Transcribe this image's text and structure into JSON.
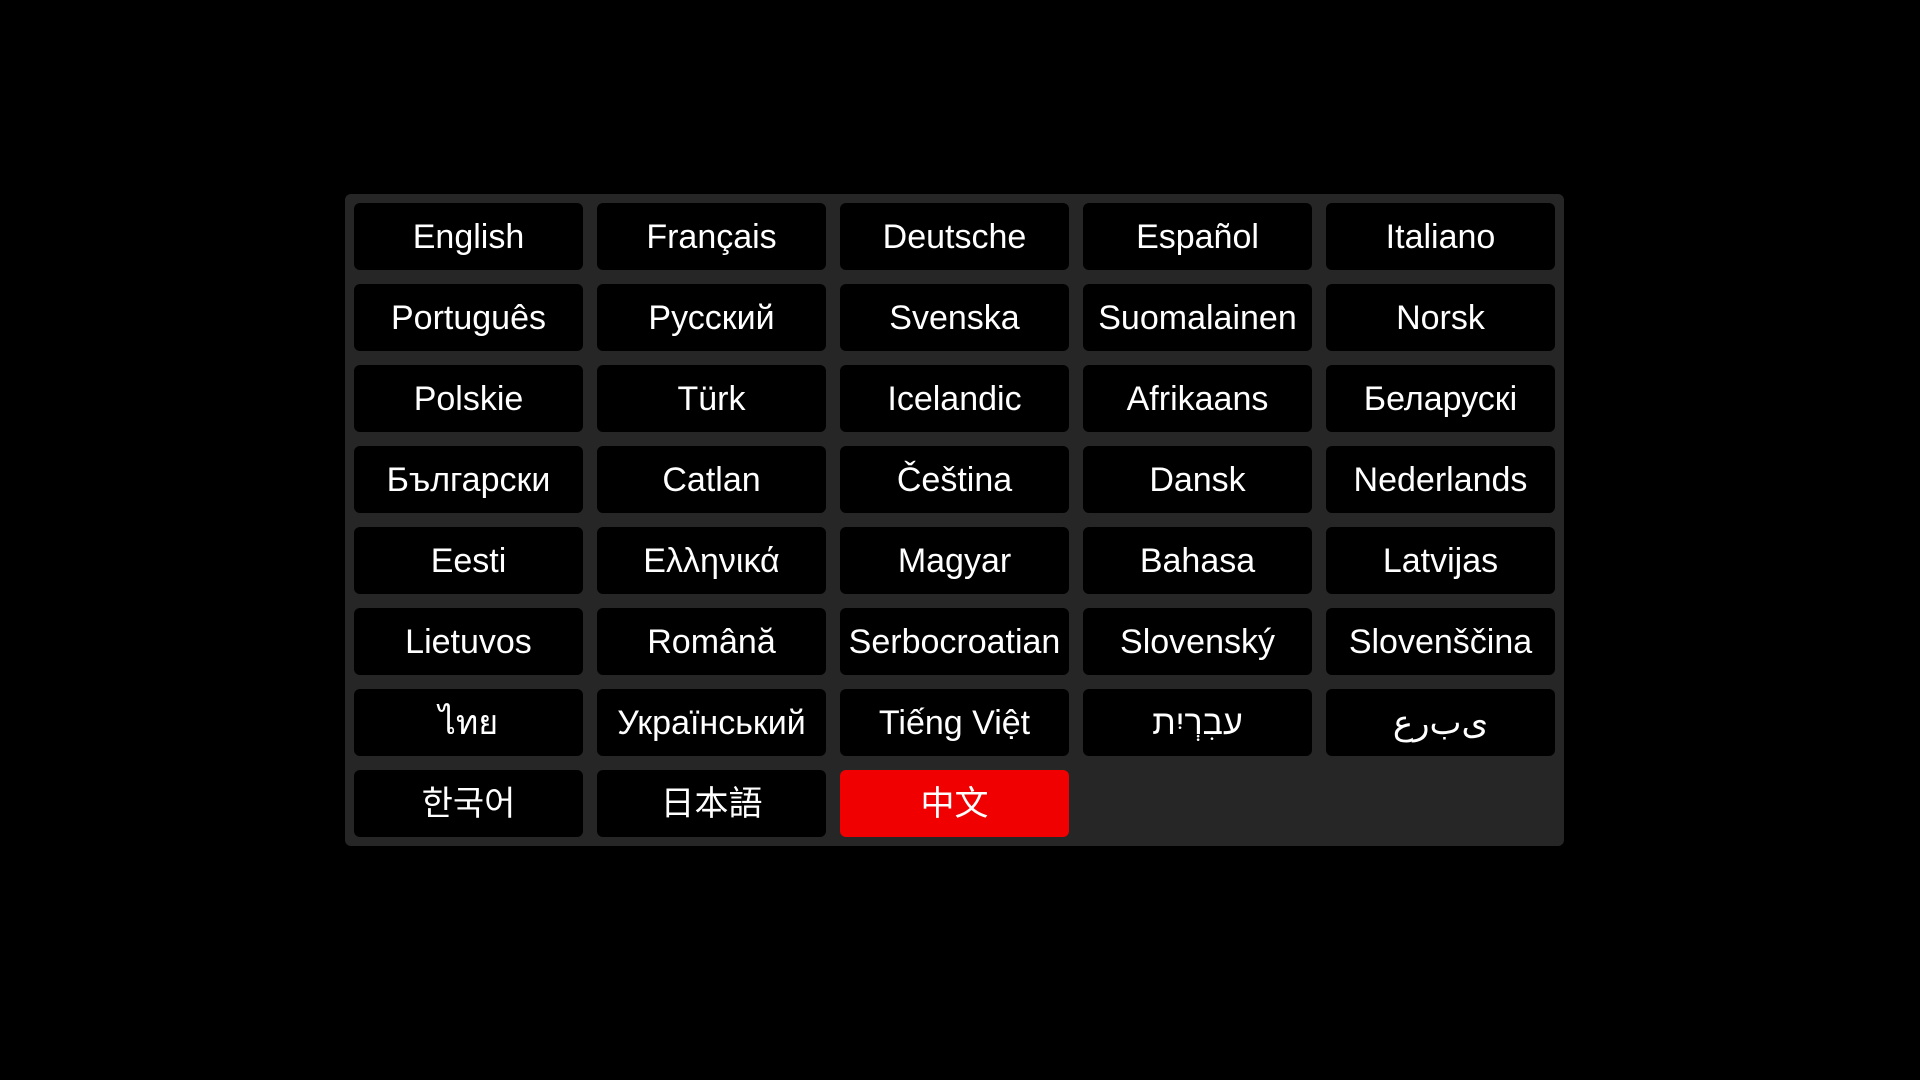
{
  "language_selector": {
    "colors": {
      "panel_background": "#262626",
      "button_background": "#000000",
      "selected_background": "#f00000",
      "text": "#ffffff"
    },
    "selected_index": 32,
    "languages": [
      {
        "id": "english",
        "label": "English"
      },
      {
        "id": "french",
        "label": "Français"
      },
      {
        "id": "german",
        "label": "Deutsche"
      },
      {
        "id": "spanish",
        "label": "Español"
      },
      {
        "id": "italian",
        "label": "Italiano"
      },
      {
        "id": "portuguese",
        "label": "Português"
      },
      {
        "id": "russian",
        "label": "Русский"
      },
      {
        "id": "swedish",
        "label": "Svenska"
      },
      {
        "id": "finnish",
        "label": "Suomalainen"
      },
      {
        "id": "norwegian",
        "label": "Norsk"
      },
      {
        "id": "polish",
        "label": "Polskie"
      },
      {
        "id": "turkish",
        "label": "Türk"
      },
      {
        "id": "icelandic",
        "label": "Icelandic"
      },
      {
        "id": "afrikaans",
        "label": "Afrikaans"
      },
      {
        "id": "belarusian",
        "label": "Беларускі"
      },
      {
        "id": "bulgarian",
        "label": "Български"
      },
      {
        "id": "catalan",
        "label": "Catlan"
      },
      {
        "id": "czech",
        "label": "Čeština"
      },
      {
        "id": "danish",
        "label": "Dansk"
      },
      {
        "id": "dutch",
        "label": "Nederlands"
      },
      {
        "id": "estonian",
        "label": "Eesti"
      },
      {
        "id": "greek",
        "label": "Ελληνικά"
      },
      {
        "id": "hungarian",
        "label": "Magyar"
      },
      {
        "id": "indonesian",
        "label": "Bahasa"
      },
      {
        "id": "latvian",
        "label": "Latvijas"
      },
      {
        "id": "lithuanian",
        "label": "Lietuvos"
      },
      {
        "id": "romanian",
        "label": "Română"
      },
      {
        "id": "serbocroatian",
        "label": "Serbocroatian"
      },
      {
        "id": "slovak",
        "label": "Slovenský"
      },
      {
        "id": "slovenian",
        "label": "Slovenščina"
      },
      {
        "id": "thai",
        "label": "ไทย"
      },
      {
        "id": "ukrainian",
        "label": "Український"
      },
      {
        "id": "vietnamese",
        "label": "Tiếng Việt"
      },
      {
        "id": "hebrew",
        "label": "תיִרְבִע",
        "visual_ltr": true
      },
      {
        "id": "arabic",
        "label": "ﻉﺭﺏﻯ",
        "visual_ltr": true
      },
      {
        "id": "korean",
        "label": "한국어",
        "cjk": true
      },
      {
        "id": "japanese",
        "label": "日本語",
        "cjk": true
      },
      {
        "id": "chinese",
        "label": "中文",
        "cjk": true,
        "selected": true
      }
    ]
  }
}
